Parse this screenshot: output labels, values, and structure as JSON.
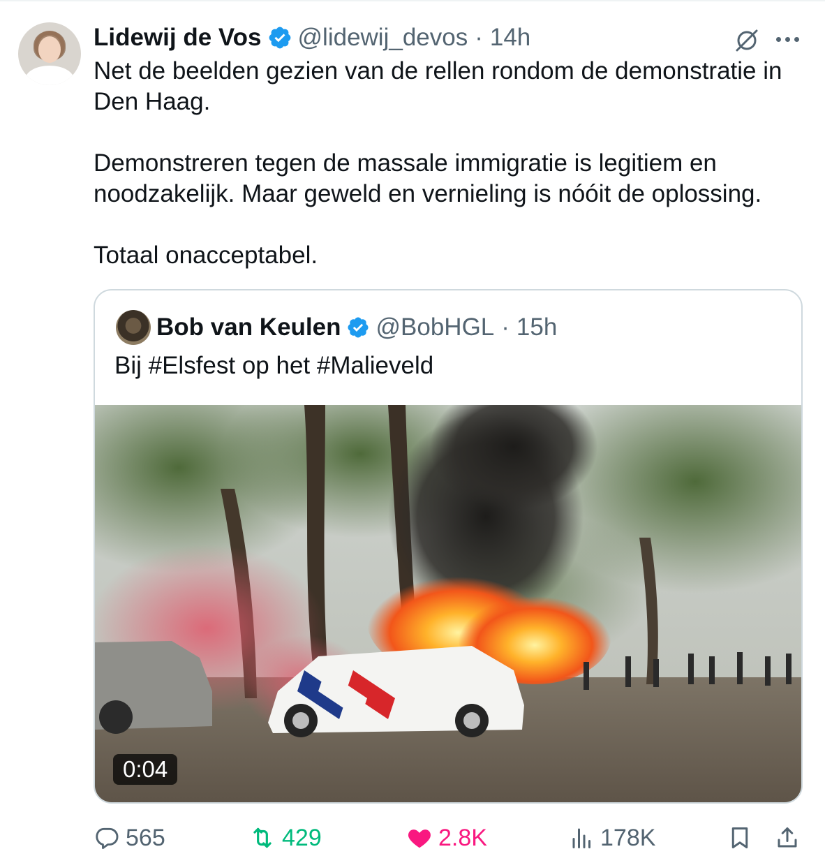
{
  "tweet": {
    "author_name": "Lidewij de Vos",
    "handle": "@lidewij_devos",
    "separator": "·",
    "time": "14h",
    "text": "Net de beelden gezien van de rellen rondom de demonstratie in Den Haag.\n\nDemonstreren tegen de massale immigratie is legitiem en noodzakelijk. Maar geweld en vernieling is nóóit de oplossing.\n\nTotaal onacceptabel."
  },
  "quoted_tweet": {
    "author_name": "Bob van Keulen",
    "handle": "@BobHGL",
    "separator": "·",
    "time": "15h",
    "text": "Bij #Elsfest op het #Malieveld",
    "video_duration": "0:04"
  },
  "actions": {
    "replies": "565",
    "reposts": "429",
    "likes": "2.8K",
    "views": "178K"
  },
  "icons": [
    "verified-badge-icon",
    "grok-icon",
    "more-icon",
    "reply-icon",
    "repost-icon",
    "heart-icon",
    "views-icon",
    "bookmark-icon",
    "share-icon"
  ],
  "colors": {
    "verified": "#1d9bf0",
    "repost_active": "#00ba7c",
    "like_active": "#f91880",
    "muted": "#536471"
  }
}
